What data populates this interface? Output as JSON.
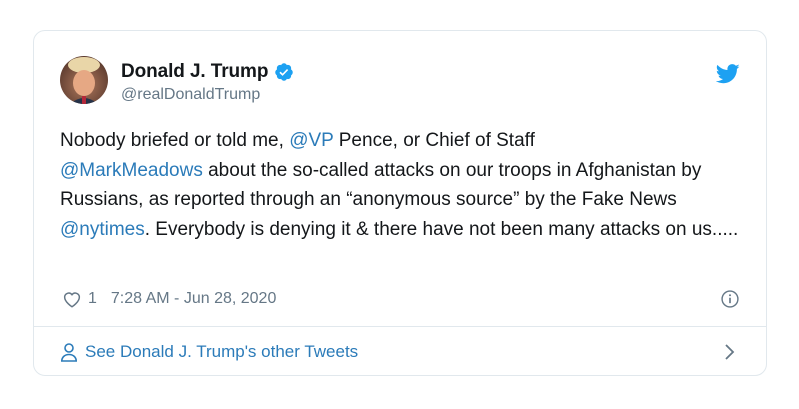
{
  "author": {
    "display_name": "Donald J. Trump",
    "handle": "@realDonaldTrump",
    "verified": true
  },
  "tweet": {
    "segments": [
      {
        "text": "Nobody briefed or told me, ",
        "mention": false
      },
      {
        "text": "@VP",
        "mention": true
      },
      {
        "text": " Pence, or Chief of Staff ",
        "mention": false
      },
      {
        "text": "@MarkMeadows",
        "mention": true
      },
      {
        "text": " about the so-called attacks on our troops in Afghanistan by Russians, as reported through an “anonymous source” by the Fake News ",
        "mention": false
      },
      {
        "text": "@nytimes",
        "mention": true
      },
      {
        "text": ". Everybody is denying it & there have not been many attacks on us.....",
        "mention": false
      }
    ]
  },
  "meta": {
    "like_count": "1",
    "timestamp": "7:28 AM - Jun 28, 2020"
  },
  "footer": {
    "link_label": "See Donald J. Trump's other Tweets"
  },
  "icons": {
    "verified": "verified-badge-icon",
    "brand": "twitter-bird-icon",
    "like": "heart-icon",
    "info": "info-icon",
    "person": "person-icon",
    "chevron": "chevron-right-icon"
  },
  "colors": {
    "link": "#2b7bb9",
    "brand": "#1da1f2",
    "muted": "#657786",
    "text": "#14171a",
    "border": "#e1e8ed"
  }
}
